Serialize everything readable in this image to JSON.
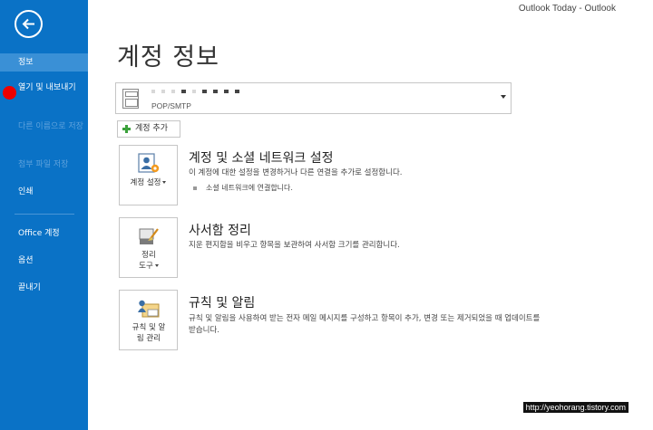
{
  "window": {
    "title": "Outlook Today - Outlook"
  },
  "sidebar": {
    "items": [
      {
        "label": "정보",
        "state": "active"
      },
      {
        "label": "열기 및 내보내기",
        "state": "normal"
      },
      {
        "label": "다른 이름으로 저장",
        "state": "disabled"
      },
      {
        "label": "첨부 파일 저장",
        "state": "disabled"
      },
      {
        "label": "인쇄",
        "state": "normal"
      },
      {
        "label": "Office 계정",
        "state": "normal"
      },
      {
        "label": "옵션",
        "state": "normal"
      },
      {
        "label": "끝내기",
        "state": "normal"
      }
    ]
  },
  "main": {
    "title": "계정 정보",
    "account": {
      "type": "POP/SMTP"
    },
    "add_account_label": "계정 추가",
    "sections": [
      {
        "button_label": "계정 설정",
        "title": "계정 및 소셜 네트워크 설정",
        "description": "이 계정에 대한 설정을 변경하거나 다른 연결을 추가로 설정합니다.",
        "link": "소셜 네트워크에 연결합니다."
      },
      {
        "button_label": "정리 도구",
        "title": "사서함 정리",
        "description": "지운 편지함을 비우고 항목을 보관하여 사서함 크기를 관리합니다."
      },
      {
        "button_label": "규칙 및 알림 관리",
        "title": "규칙 및 알림",
        "description": "규칙 및 알림을 사용하여 받는 전자 메일 메시지를 구성하고 항목이 추가, 변경 또는 제거되었을 때 업데이트를 받습니다."
      }
    ]
  },
  "watermark": "http://yeohorang.tistory.com",
  "colors": {
    "sidebar": "#0a72c6",
    "sidebar_active": "#3a90d6",
    "plus": "#3ba13b",
    "annotation_dot": "#ee0000"
  }
}
